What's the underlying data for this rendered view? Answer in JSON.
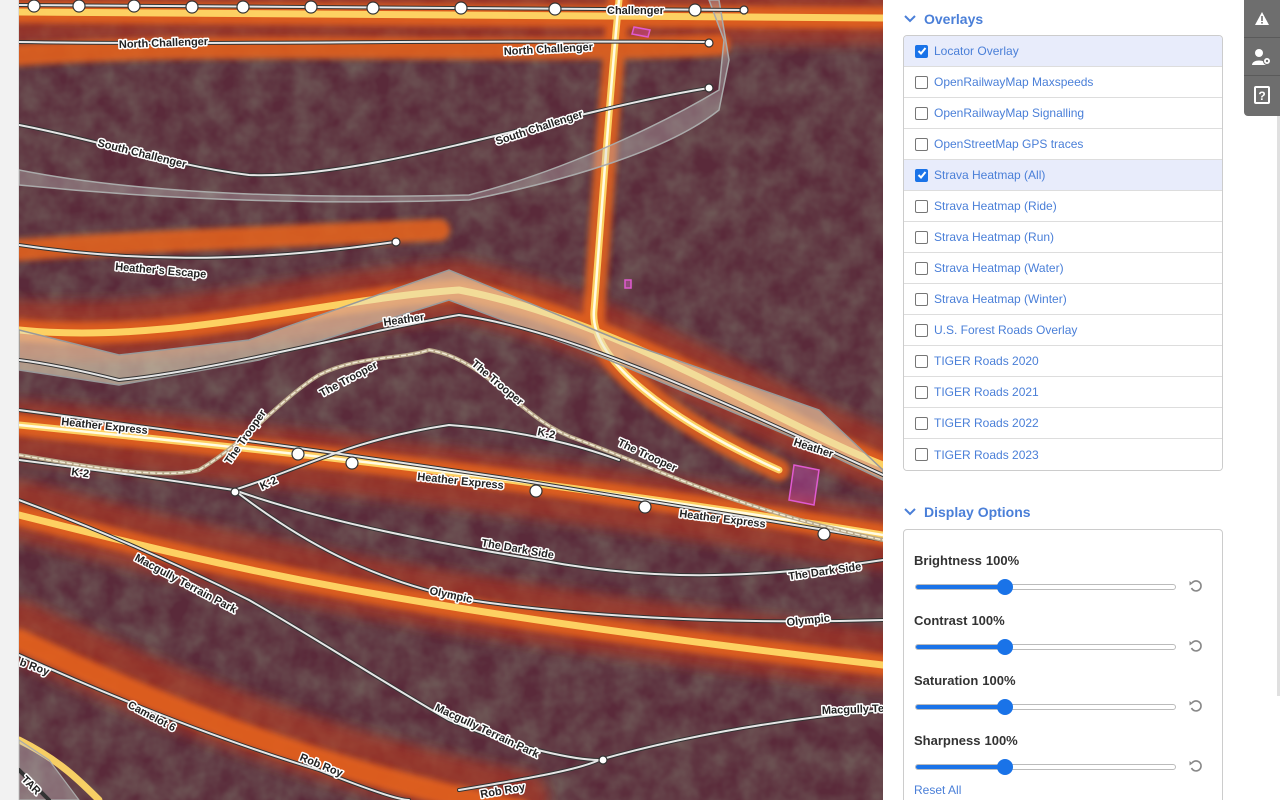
{
  "map": {
    "road_labels": [
      "Challenger",
      "North Challenger",
      "North Challenger",
      "South Challenger",
      "South Challenger",
      "Heather's Escape",
      "Heather",
      "Heather",
      "The Trooper",
      "The Trooper",
      "The Trooper",
      "The Trooper",
      "Heather Express",
      "Heather Express",
      "Heather Express",
      "K-2",
      "K-2",
      "K-2",
      "The Dark Side",
      "The Dark Side",
      "Olympic",
      "Olympic",
      "Macgully Terrain Park",
      "Macgully Terrain Park",
      "Macgully Te",
      "Camelot 6",
      "Rob Roy",
      "Rob Roy",
      "b Roy",
      "TAR"
    ]
  },
  "sidebar": {
    "overlays_title": "Overlays",
    "overlays": [
      {
        "label": "Locator Overlay",
        "checked": true
      },
      {
        "label": "OpenRailwayMap Maxspeeds",
        "checked": false
      },
      {
        "label": "OpenRailwayMap Signalling",
        "checked": false
      },
      {
        "label": "OpenStreetMap GPS traces",
        "checked": false
      },
      {
        "label": "Strava Heatmap (All)",
        "checked": true
      },
      {
        "label": "Strava Heatmap (Ride)",
        "checked": false
      },
      {
        "label": "Strava Heatmap (Run)",
        "checked": false
      },
      {
        "label": "Strava Heatmap (Water)",
        "checked": false
      },
      {
        "label": "Strava Heatmap (Winter)",
        "checked": false
      },
      {
        "label": "U.S. Forest Roads Overlay",
        "checked": false
      },
      {
        "label": "TIGER Roads 2020",
        "checked": false
      },
      {
        "label": "TIGER Roads 2021",
        "checked": false
      },
      {
        "label": "TIGER Roads 2022",
        "checked": false
      },
      {
        "label": "TIGER Roads 2023",
        "checked": false
      }
    ],
    "display_title": "Display Options",
    "sliders": [
      {
        "name": "Brightness",
        "value": "100%",
        "fraction": 0.345
      },
      {
        "name": "Contrast",
        "value": "100%",
        "fraction": 0.345
      },
      {
        "name": "Saturation",
        "value": "100%",
        "fraction": 0.345
      },
      {
        "name": "Sharpness",
        "value": "100%",
        "fraction": 0.345
      }
    ],
    "reset_all": "Reset All"
  },
  "toolbar": {
    "icons": [
      "warning-icon",
      "user-settings-icon",
      "help-icon"
    ]
  },
  "colors": {
    "accent": "#4a7fd8",
    "checkbox": "#1a73e8",
    "heat_low": "#6b1f3a",
    "heat_mid": "#e8501a",
    "heat_high": "#ffe38a"
  }
}
